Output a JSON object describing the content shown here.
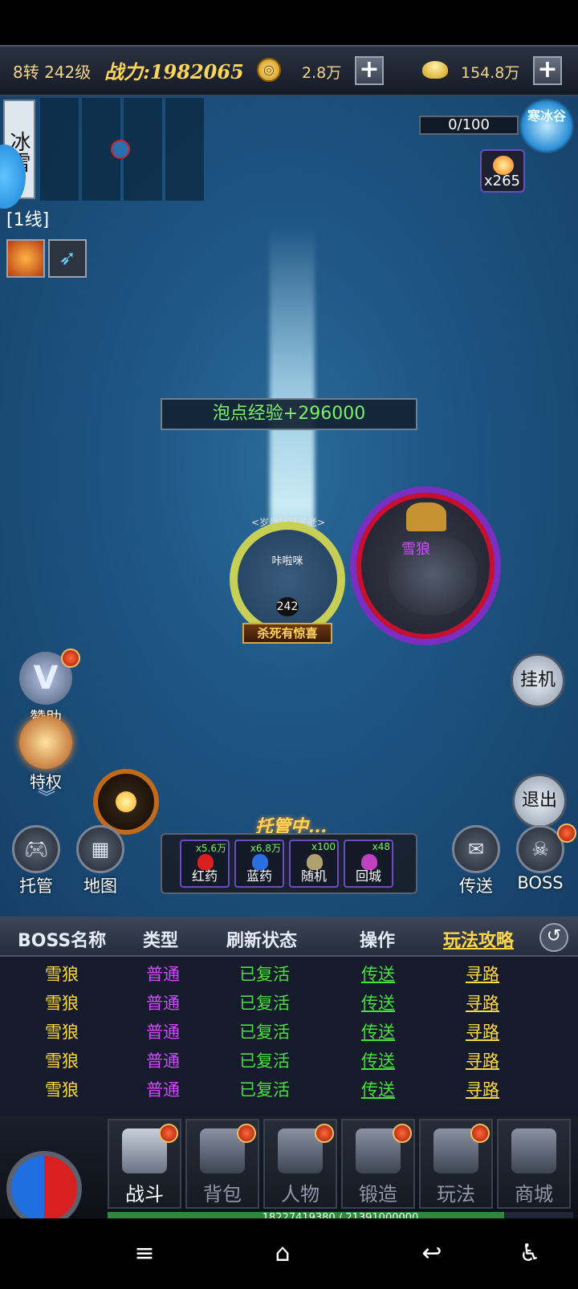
{
  "topbar": {
    "level": "8转 242级",
    "power": "战力:1982065",
    "coin_value": "2.8万",
    "ingot_value": "154.8万",
    "plus": "+"
  },
  "map": {
    "name": "冰雪",
    "line": "[1线]"
  },
  "event": {
    "progress": "0/100",
    "emblem": "寒冰谷",
    "item_count": "x265"
  },
  "battle": {
    "exp_text": "泡点经验+296000",
    "player_name": "咔啦咪",
    "player_level": "242",
    "guild_tag": "<岁月轻狂长老>",
    "kill_banner": "杀死有惊喜",
    "boss_name": "雪狼"
  },
  "left_buttons": {
    "sponsor": "赞助",
    "privilege": "特权",
    "sponsor_icon": "V"
  },
  "right_buttons": {
    "afk": "挂机",
    "exit": "退出"
  },
  "auto_status": "托管中...",
  "round_buttons": {
    "auto": "托管",
    "map": "地图",
    "teleport": "传送",
    "boss": "BOSS"
  },
  "potions": [
    {
      "qty": "x5.6万",
      "label": "红药",
      "color": "#d92020"
    },
    {
      "qty": "x6.8万",
      "label": "蓝药",
      "color": "#2a6fe0"
    },
    {
      "qty": "x100",
      "label": "随机",
      "color": "#b0a070"
    },
    {
      "qty": "x48",
      "label": "回城",
      "color": "#c040c0"
    }
  ],
  "boss_table": {
    "headers": {
      "name": "BOSS名称",
      "type": "类型",
      "state": "刷新状态",
      "action": "操作",
      "guide": "玩法攻略"
    },
    "back_icon": "↺",
    "rows": [
      {
        "name": "雪狼",
        "type": "普通",
        "state": "已复活",
        "tp": "传送",
        "path": "寻路"
      },
      {
        "name": "雪狼",
        "type": "普通",
        "state": "已复活",
        "tp": "传送",
        "path": "寻路"
      },
      {
        "name": "雪狼",
        "type": "普通",
        "state": "已复活",
        "tp": "传送",
        "path": "寻路"
      },
      {
        "name": "雪狼",
        "type": "普通",
        "state": "已复活",
        "tp": "传送",
        "path": "寻路"
      },
      {
        "name": "雪狼",
        "type": "普通",
        "state": "已复活",
        "tp": "传送",
        "path": "寻路"
      }
    ]
  },
  "bottom_nav": {
    "items": [
      "战斗",
      "背包",
      "人物",
      "锻造",
      "玩法",
      "商城"
    ],
    "exp_text": "18227419380 / 21391000000",
    "exp_fraction": 0.852
  },
  "system_nav": {
    "menu": "≡",
    "home": "⌂",
    "back": "↩",
    "accessibility": "♿"
  }
}
